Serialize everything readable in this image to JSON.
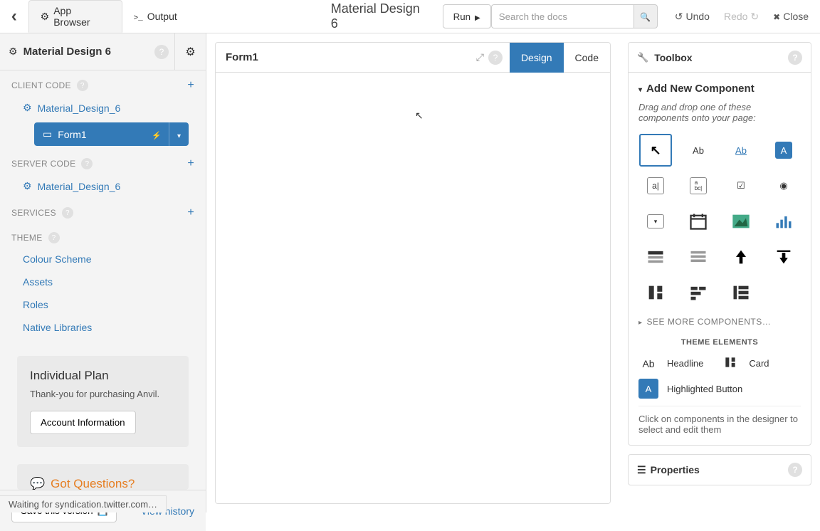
{
  "topbar": {
    "tab_browser": "App Browser",
    "tab_output": "Output",
    "app_title": "Material Design 6",
    "run": "Run",
    "search_placeholder": "Search the docs",
    "undo": "Undo",
    "redo": "Redo",
    "close": "Close"
  },
  "sidebar": {
    "title": "Material Design 6",
    "sections": {
      "client": "CLIENT CODE",
      "server": "SERVER CODE",
      "services": "SERVICES",
      "theme": "THEME"
    },
    "client_item": "Material_Design_6",
    "form_item": "Form1",
    "server_item": "Material_Design_6",
    "theme_items": [
      "Colour Scheme",
      "Assets",
      "Roles",
      "Native Libraries"
    ],
    "plan": {
      "title": "Individual Plan",
      "thanks": "Thank-you for purchasing Anvil.",
      "button": "Account Information"
    },
    "questions_title": "Got Questions?",
    "save": "Save this version",
    "history": "View history"
  },
  "center": {
    "form_title": "Form1",
    "tab_design": "Design",
    "tab_code": "Code"
  },
  "toolbox": {
    "title": "Toolbox",
    "add_title": "Add New Component",
    "add_desc": "Drag and drop one of these components onto your page:",
    "see_more": "SEE MORE COMPONENTS…",
    "theme_elements": "THEME ELEMENTS",
    "headline": "Headline",
    "card": "Card",
    "highlighted": "Highlighted Button",
    "click_hint": "Click on components in the designer to select and edit them"
  },
  "properties": {
    "title": "Properties"
  },
  "status": "Waiting for syndication.twitter.com…"
}
